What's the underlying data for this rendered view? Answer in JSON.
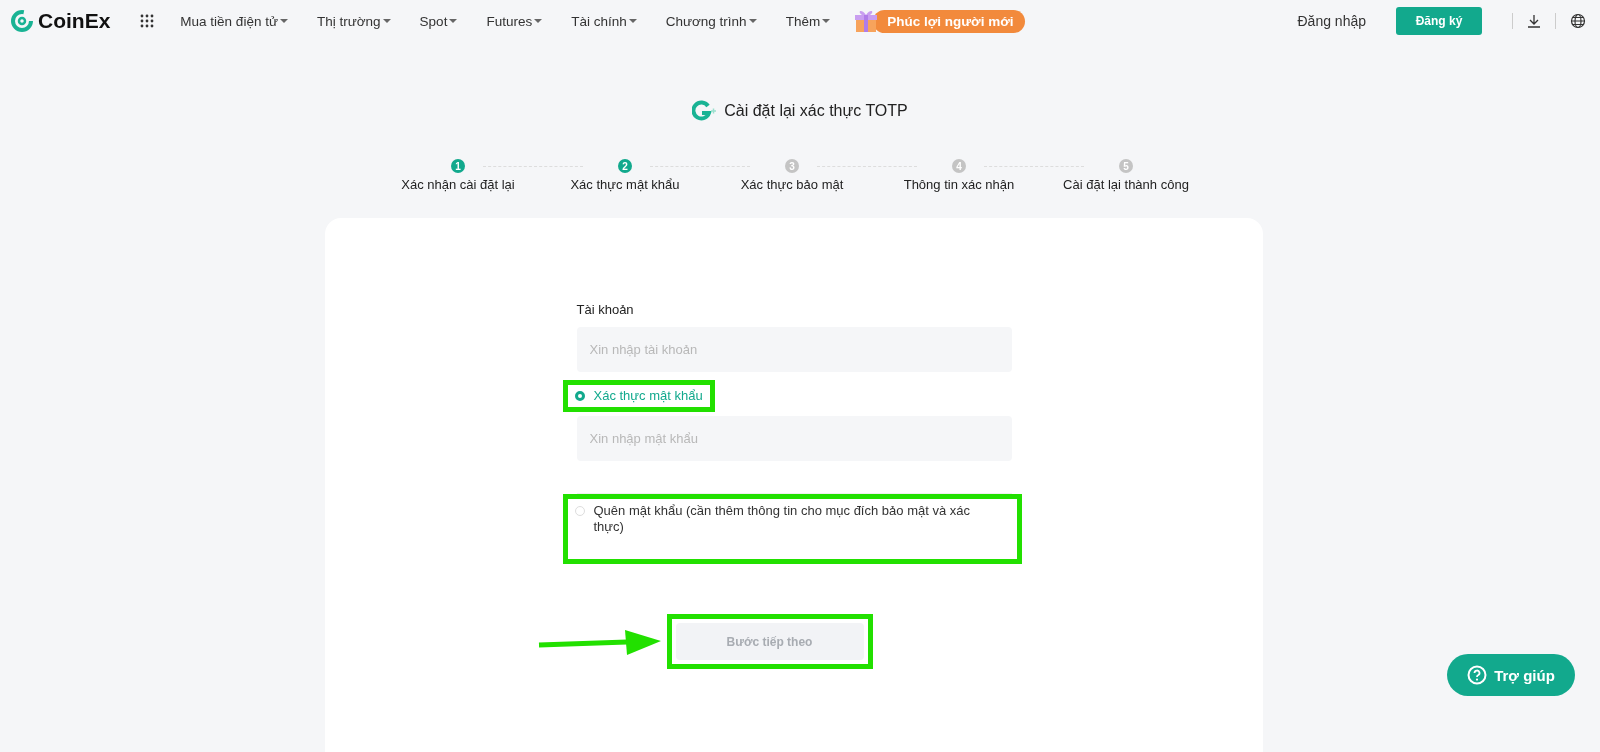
{
  "header": {
    "logo": "CoinEx",
    "nav": [
      {
        "label": "Mua tiền điện tử",
        "dropdown": true
      },
      {
        "label": "Thị trường",
        "dropdown": true
      },
      {
        "label": "Spot",
        "dropdown": true
      },
      {
        "label": "Futures",
        "dropdown": true
      },
      {
        "label": "Tài chính",
        "dropdown": true
      },
      {
        "label": "Chương trình",
        "dropdown": true
      },
      {
        "label": "Thêm",
        "dropdown": true
      }
    ],
    "promo": "Phúc lợi người mới",
    "login": "Đăng nhập",
    "signup": "Đăng ký"
  },
  "title": "Cài đặt lại xác thực TOTP",
  "steps": [
    {
      "number": "1",
      "label": "Xác nhận cài đặt lại",
      "reached": true
    },
    {
      "number": "2",
      "label": "Xác thực mật khẩu",
      "reached": true
    },
    {
      "number": "3",
      "label": "Xác thực bảo mật",
      "reached": false
    },
    {
      "number": "4",
      "label": "Thông tin xác nhận",
      "reached": false
    },
    {
      "number": "5",
      "label": "Cài đặt lại thành công",
      "reached": false
    }
  ],
  "form": {
    "account_label": "Tài khoản",
    "account_placeholder": "Xin nhập tài khoản",
    "options": [
      {
        "label": "Xác thực mật khẩu",
        "selected": true,
        "highlighted": true,
        "placeholder": "Xin nhập mật khẩu"
      },
      {
        "label": "Quên mật khẩu (cần thêm thông tin cho mục đích bảo mật và xác thực)",
        "selected": false,
        "highlighted": true
      }
    ],
    "next_button": {
      "label": "Bước tiếp theo",
      "disabled": true,
      "highlighted": true
    }
  },
  "help": "Trợ giúp"
}
